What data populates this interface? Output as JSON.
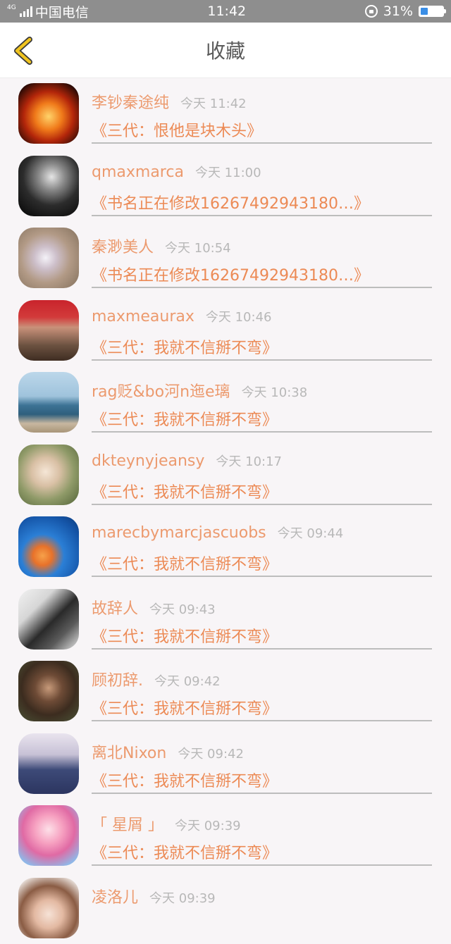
{
  "status_bar": {
    "network": "4G",
    "carrier": "中国电信",
    "time": "11:42",
    "battery_percent": "31%",
    "battery_level": 0.31
  },
  "header": {
    "title": "收藏",
    "back_icon": "chevron-left-icon",
    "back_color": "#f0c420"
  },
  "items": [
    {
      "name": "李钞秦途纯",
      "time": "今天 11:42",
      "book": "《三代：恨他是块木头》"
    },
    {
      "name": "qmaxmarca",
      "time": "今天 11:00",
      "book": "《书名正在修改16267492943180…》"
    },
    {
      "name": "秦渺美人",
      "time": "今天 10:54",
      "book": "《书名正在修改16267492943180…》"
    },
    {
      "name": "maxmeaurax",
      "time": "今天 10:46",
      "book": "《三代：我就不信掰不弯》"
    },
    {
      "name": "rag贬&bo河n迤e璃",
      "time": "今天 10:38",
      "book": "《三代：我就不信掰不弯》"
    },
    {
      "name": "dkteynyjeansy",
      "time": "今天 10:17",
      "book": "《三代：我就不信掰不弯》"
    },
    {
      "name": "marecbymarcjascuobs",
      "time": "今天 09:44",
      "book": "《三代：我就不信掰不弯》"
    },
    {
      "name": "故辞人",
      "time": "今天 09:43",
      "book": "《三代：我就不信掰不弯》"
    },
    {
      "name": "顾初辞.",
      "time": "今天 09:42",
      "book": "《三代：我就不信掰不弯》"
    },
    {
      "name": "离北Nixon",
      "time": "今天 09:42",
      "book": "《三代：我就不信掰不弯》"
    },
    {
      "name": "「 星屑 」",
      "time": "今天 09:39",
      "book": "《三代：我就不信掰不弯》"
    },
    {
      "name": "凌洛儿",
      "time": "今天 09:39",
      "book": ""
    }
  ],
  "colors": {
    "name": "#ec9a6e",
    "book": "#ec8a55",
    "time": "#b8b8b8",
    "background": "#f8f5f7"
  }
}
